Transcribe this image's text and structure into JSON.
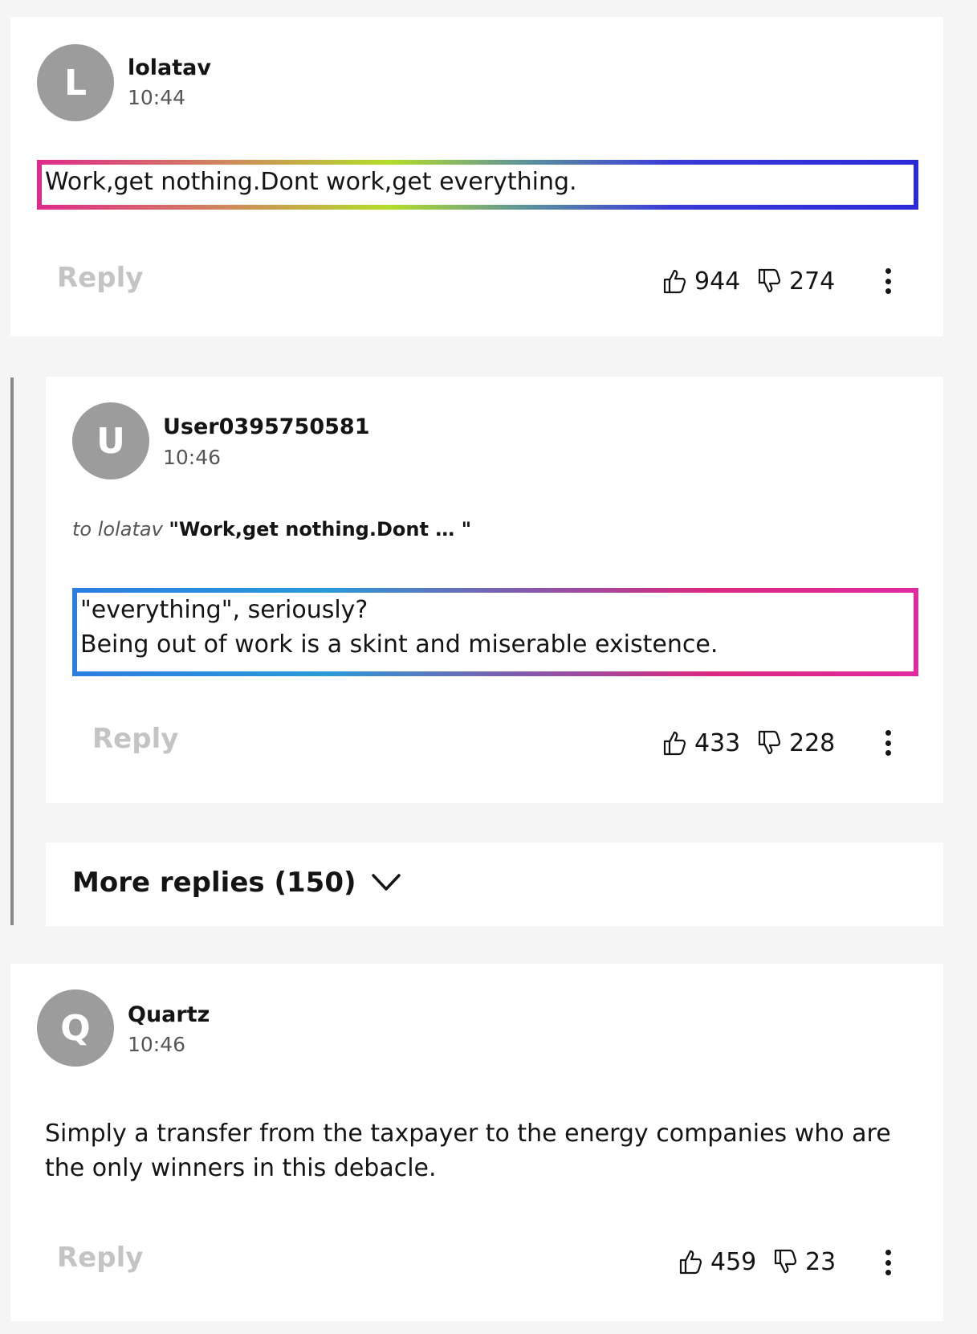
{
  "comments": [
    {
      "avatar_letter": "L",
      "username": "lolatav",
      "time": "10:44",
      "text": "Work,get nothing.Dont work,get everything.",
      "reply_label": "Reply",
      "likes": "944",
      "dislikes": "274"
    },
    {
      "avatar_letter": "U",
      "username": "User0395750581",
      "time": "10:46",
      "to_label": "to lolatav",
      "quote": "\"Work,get nothing.Dont … \"",
      "text_line1": "\"everything\", seriously?",
      "text_line2": "Being out of work is a skint and miserable existence.",
      "reply_label": "Reply",
      "likes": "433",
      "dislikes": "228"
    },
    {
      "avatar_letter": "Q",
      "username": "Quartz",
      "time": "10:46",
      "text_line1": "Simply a transfer from the taxpayer to the energy companies who are",
      "text_line2": "the only winners in this debacle.",
      "reply_label": "Reply",
      "likes": "459",
      "dislikes": "23"
    }
  ],
  "more_replies_label": "More replies (150)",
  "icons": {
    "like": "thumbs-up-icon",
    "dislike": "thumbs-down-icon",
    "more": "more-vertical-icon",
    "expand": "chevron-down-icon"
  },
  "colors": {
    "background": "#f5f5f5",
    "card": "#ffffff",
    "avatar": "#9c9c9c",
    "reply_disabled": "#c4c4c4",
    "thread_line": "#8a8a8a"
  }
}
